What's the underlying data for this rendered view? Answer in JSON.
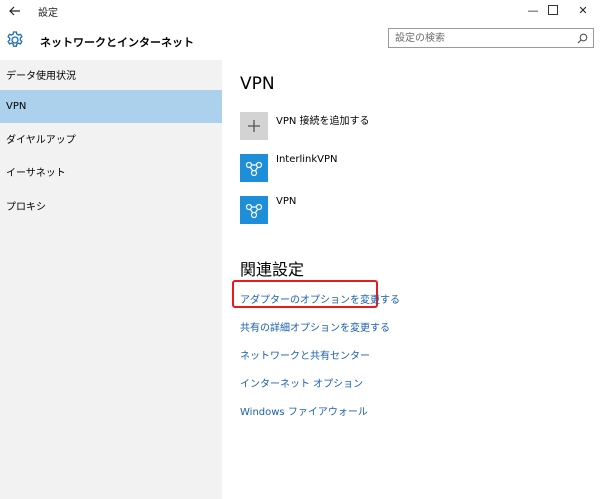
{
  "titlebar": {
    "title": "設定",
    "back_icon": "back-arrow-icon",
    "minimize_glyph": "—",
    "close_glyph": "✕"
  },
  "header": {
    "section_title": "ネットワークとインターネット",
    "gear_icon": "gear-icon",
    "search_placeholder": "設定の検索"
  },
  "sidebar": {
    "items": [
      {
        "label": "データ使用状況",
        "active": false
      },
      {
        "label": "VPN",
        "active": true
      },
      {
        "label": "ダイヤルアップ",
        "active": false
      },
      {
        "label": "イーサネット",
        "active": false
      },
      {
        "label": "プロキシ",
        "active": false
      }
    ]
  },
  "main": {
    "vpn_heading": "VPN",
    "add_vpn": {
      "icon": "plus-icon",
      "label": "VPN 接続を追加する"
    },
    "connections": [
      {
        "icon": "vpn-connection-icon",
        "label": "InterlinkVPN"
      },
      {
        "icon": "vpn-connection-icon",
        "label": "VPN"
      }
    ],
    "related_heading": "関連設定",
    "related_links": [
      {
        "label": "アダプターのオプションを変更する",
        "highlighted": true
      },
      {
        "label": "共有の詳細オプションを変更する",
        "highlighted": false
      },
      {
        "label": "ネットワークと共有センター",
        "highlighted": false
      },
      {
        "label": "インターネット オプション",
        "highlighted": false
      },
      {
        "label": "Windows ファイアウォール",
        "highlighted": false
      }
    ]
  },
  "colors": {
    "sidebar_bg": "#f2f2f2",
    "sidebar_active": "#abd1ec",
    "link": "#1a5fb4",
    "vpn_tile": "#1d8ed8",
    "add_tile": "#d3d3d3",
    "highlight_border": "#e81b1b"
  }
}
